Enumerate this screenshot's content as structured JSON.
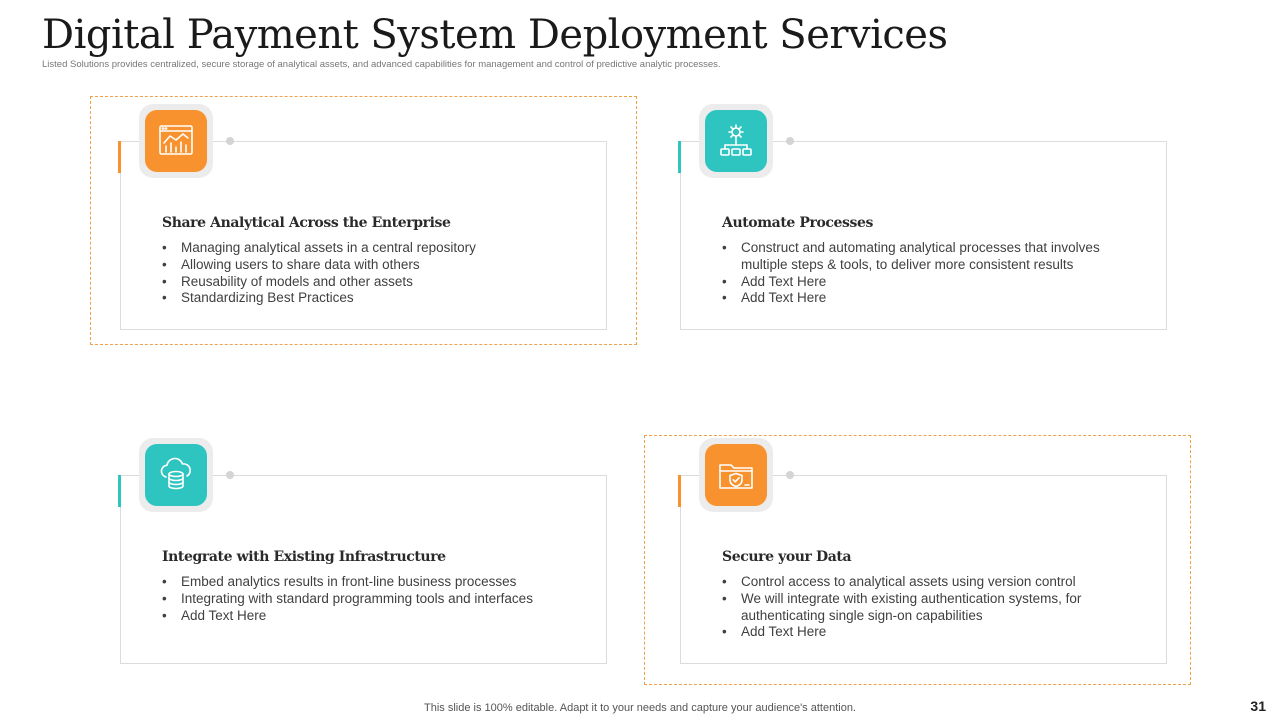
{
  "slide": {
    "title": "Digital Payment System Deployment Services",
    "subtitle": "Listed Solutions provides centralized, secure storage of analytical assets, and advanced capabilities for management and control of predictive analytic processes.",
    "footer": "This slide is 100% editable. Adapt it to your needs and capture your audience's attention.",
    "page_number": "31"
  },
  "colors": {
    "orange": "#f7922e",
    "teal": "#2ec4bf",
    "dashed_frame": "#f0a04b"
  },
  "cards": [
    {
      "icon": "analytics-dashboard-icon",
      "accent": "orange",
      "heading": "Share Analytical Across the Enterprise",
      "bullets": [
        "Managing analytical assets in a central repository",
        "Allowing users to share data with others",
        "Reusability of models and other assets",
        "Standardizing Best Practices"
      ]
    },
    {
      "icon": "gear-workflow-icon",
      "accent": "teal",
      "heading": "Automate Processes",
      "bullets": [
        "Construct and automating analytical processes that involves multiple steps & tools, to deliver more consistent results",
        "Add Text Here",
        "Add Text Here"
      ]
    },
    {
      "icon": "cloud-database-icon",
      "accent": "teal",
      "heading": "Integrate with Existing Infrastructure",
      "bullets": [
        "Embed analytics results in front-line business processes",
        "Integrating with standard programming tools and interfaces",
        "Add Text Here"
      ]
    },
    {
      "icon": "secure-folder-icon",
      "accent": "orange",
      "heading": "Secure your Data",
      "bullets": [
        "Control access to analytical assets using version control",
        "We will integrate with existing authentication systems, for authenticating single sign-on capabilities",
        "Add Text Here"
      ]
    }
  ]
}
